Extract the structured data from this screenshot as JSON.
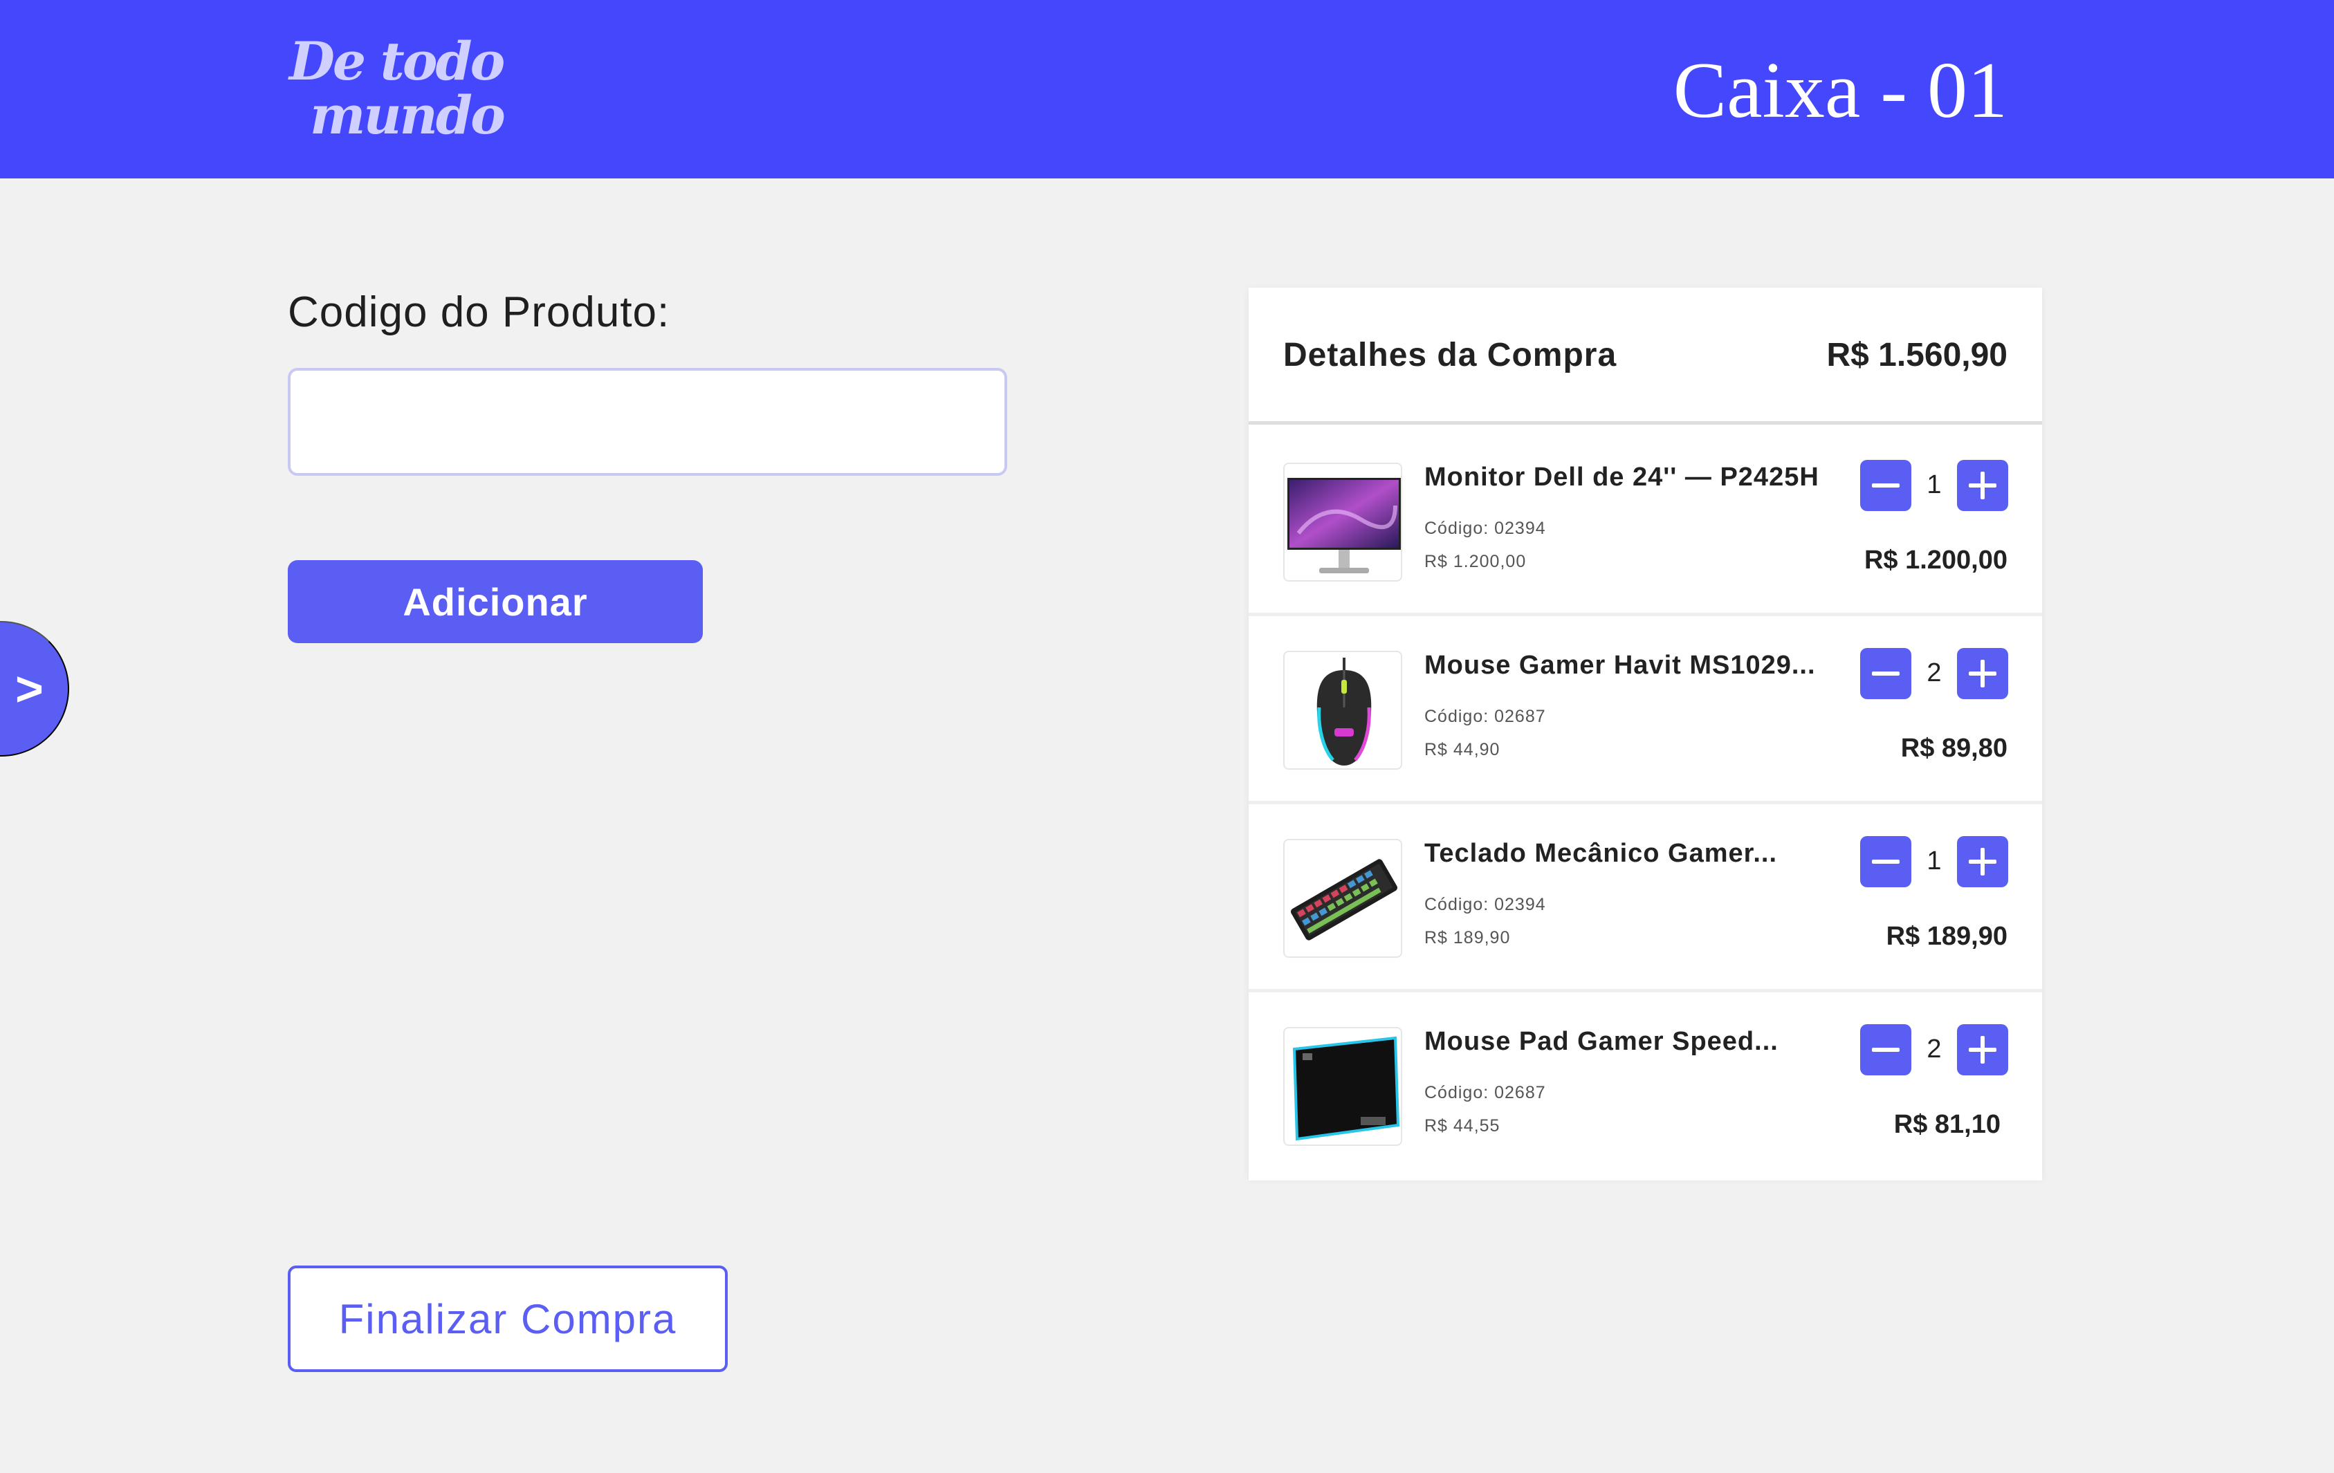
{
  "header": {
    "logo_line1": "De todo",
    "logo_line2": "mundo",
    "register_title": "Caixa - 01",
    "background_color": "#4447fc"
  },
  "form": {
    "code_label": "Codigo do Produto:",
    "code_value": "",
    "add_label": "Adicionar"
  },
  "sidebar_toggle": {
    "label": ">"
  },
  "finish": {
    "label": "Finalizar Compra"
  },
  "accent_color": "#5b5ef2",
  "cart": {
    "title": "Detalhes da Compra",
    "total": "R$ 1.560,90",
    "items": [
      {
        "name": "Monitor Dell de 24'' — P2425H",
        "code": "Código: 02394",
        "unit_price": "R$ 1.200,00",
        "quantity": "1",
        "line_total": "R$ 1.200,00",
        "image_icon": "monitor-image"
      },
      {
        "name": "Mouse Gamer Havit MS1029...",
        "code": "Código: 02687",
        "unit_price": "R$ 44,90",
        "quantity": "2",
        "line_total": "R$ 89,80",
        "image_icon": "mouse-image"
      },
      {
        "name": "Teclado Mecânico Gamer...",
        "code": "Código: 02394",
        "unit_price": "R$ 189,90",
        "quantity": "1",
        "line_total": "R$ 189,90",
        "image_icon": "keyboard-image"
      },
      {
        "name": "Mouse Pad Gamer Speed...",
        "code": "Código: 02687",
        "unit_price": "R$ 44,55",
        "quantity": "2",
        "line_total": "R$ 81,10",
        "image_icon": "mousepad-image"
      }
    ]
  }
}
